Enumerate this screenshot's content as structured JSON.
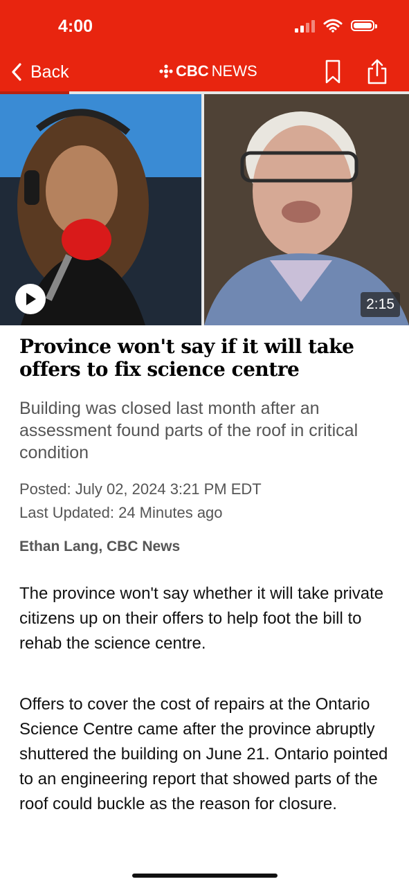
{
  "status_bar": {
    "time": "4:00"
  },
  "nav": {
    "back_label": "Back",
    "logo_brand": "CBC",
    "logo_section": "NEWS",
    "bookmark_icon": "bookmark-icon",
    "share_icon": "share-icon"
  },
  "reading_progress": 0.17,
  "video": {
    "duration": "2:15",
    "play_icon": "play-icon"
  },
  "article": {
    "headline": "Province won't say if it will take offers to fix science centre",
    "dek": "Building was closed last month after an assessment found parts of the roof in critical condition",
    "posted": "Posted: July 02, 2024 3:21 PM EDT",
    "updated": "Last Updated: 24 Minutes ago",
    "byline": "Ethan Lang, CBC News",
    "paragraphs": [
      "The province won't say whether it will take private citizens up on their offers to help foot the bill to rehab the science centre.",
      "Offers to cover the cost of repairs at the Ontario Science Centre came after the province abruptly shuttered the building on June 21. Ontario pointed to an engineering report that showed parts of the roof could buckle as the reason for closure."
    ]
  },
  "colors": {
    "brand_red": "#e8250f",
    "text_gray": "#555555"
  }
}
